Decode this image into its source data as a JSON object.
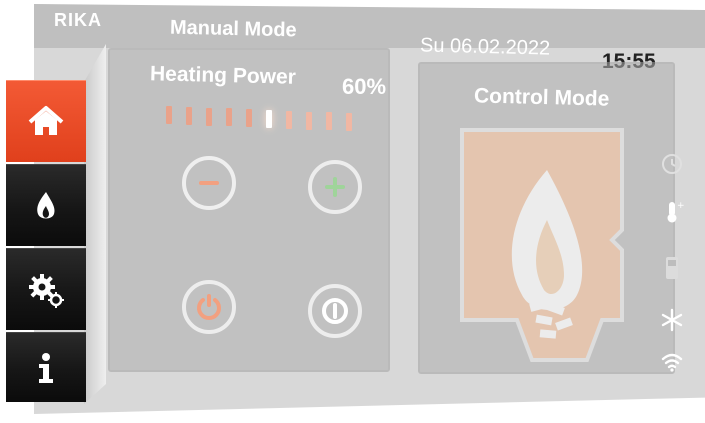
{
  "header": {
    "brand": "RIKA",
    "mode_title": "Manual Mode",
    "date": "Su 06.02.2022",
    "time": "15:55"
  },
  "heating": {
    "label": "Heating Power",
    "value": "60%",
    "level_fraction": 0.6,
    "segments_total": 10
  },
  "control": {
    "label": "Control Mode"
  },
  "menu": {
    "items": [
      {
        "name": "home",
        "icon": "home-icon",
        "active": true
      },
      {
        "name": "flame",
        "icon": "flame-icon",
        "active": false
      },
      {
        "name": "settings",
        "icon": "gears-icon",
        "active": false
      },
      {
        "name": "info",
        "icon": "info-icon",
        "active": false
      }
    ]
  },
  "status_icons": [
    "clock-icon",
    "thermometer-icon",
    "phone-icon",
    "snowflake-icon",
    "wifi-icon"
  ],
  "colors": {
    "accent": "#e84a24",
    "menu_dark": "#161616",
    "minus": "#f2a080",
    "plus": "#9fd49a",
    "power": "#f2a080"
  }
}
